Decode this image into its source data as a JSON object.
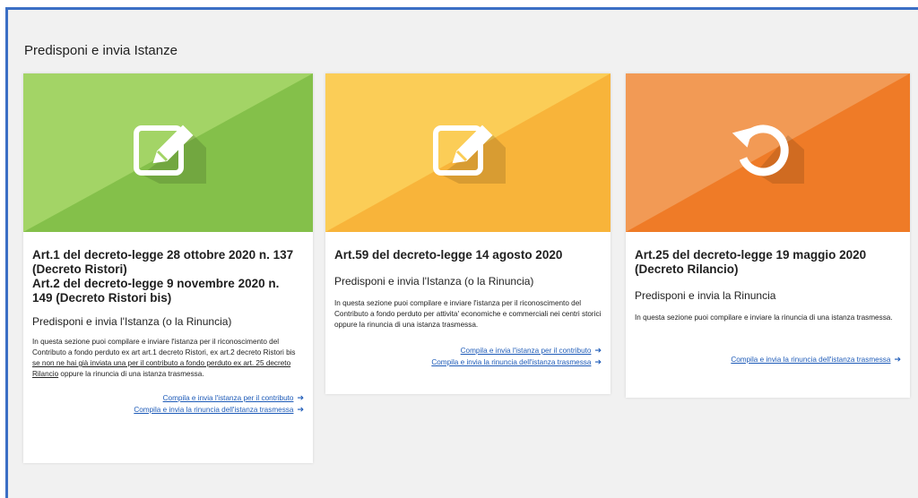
{
  "page": {
    "section_title": "Predisponi e invia Istanze"
  },
  "cards": [
    {
      "title": "Art.1 del decreto-legge 28 ottobre 2020 n. 137\n(Decreto Ristori)\nArt.2 del decreto-legge 9 novembre 2020 n.\n149 (Decreto Ristori bis)",
      "subtitle": "Predisponi e invia l'Istanza (o la Rinuncia)",
      "desc_before": "In questa sezione puoi compilare e inviare l'istanza per il riconoscimento del Contributo a fondo perduto ex art art.1 decreto Ristori, ex art.2 decreto Ristori bis ",
      "desc_underlined": "se non ne hai già inviata una per il contributo a fondo perduto ex art. 25 decreto Rilancio",
      "desc_after": " oppure la rinuncia di una istanza trasmessa.",
      "link1": "Compila e invia l'istanza per il contributo",
      "link2": "Compila e invia la rinuncia dell'istanza trasmessa",
      "icon": "edit-icon",
      "colors": {
        "light": "#a3d466",
        "dark": "#84c04a"
      }
    },
    {
      "title": "Art.59 del decreto-legge 14 agosto 2020",
      "subtitle": "Predisponi e invia l'Istanza (o la Rinuncia)",
      "desc": "In questa sezione puoi compilare e inviare l'istanza per il riconoscimento del Contributo a fondo perduto per attivita' economiche e commerciali nei centri storici oppure la rinuncia di una istanza trasmessa.",
      "link1": "Compila e invia l'istanza per il contributo",
      "link2": "Compila e invia la rinuncia dell'istanza trasmessa",
      "icon": "edit-icon",
      "colors": {
        "light": "#fbcd57",
        "dark": "#f8b43a"
      }
    },
    {
      "title": "Art.25 del decreto-legge 19 maggio 2020\n(Decreto Rilancio)",
      "subtitle": "Predisponi e invia la Rinuncia",
      "desc": "In questa sezione puoi compilare e inviare la rinuncia di una istanza trasmessa.",
      "link1": "Compila e invia la rinuncia dell'istanza trasmessa",
      "icon": "undo-icon",
      "colors": {
        "light": "#f29a55",
        "dark": "#ef7b27"
      }
    }
  ],
  "arrow_glyph": "➔"
}
